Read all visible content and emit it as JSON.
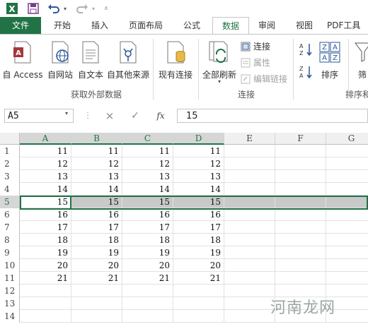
{
  "tabs": [
    "文件",
    "开始",
    "插入",
    "页面布局",
    "公式",
    "数据",
    "审阅",
    "视图",
    "PDF工具"
  ],
  "active_tab": "数据",
  "ribbon": {
    "buttons": [
      "自 Access",
      "自网站",
      "自文本",
      "自其他来源",
      "现有连接",
      "全部刷新",
      "排序",
      "筛"
    ],
    "small_items": [
      "连接",
      "属性",
      "编辑链接"
    ],
    "group_labels": [
      "获取外部数据",
      "连接",
      "排序和"
    ]
  },
  "name_box": "A5",
  "formula_value": "15",
  "formula_buttons": [
    "×",
    "✓",
    "fx"
  ],
  "columns": [
    "A",
    "B",
    "C",
    "D",
    "E",
    "F",
    "G"
  ],
  "rows": [
    {
      "num": "1",
      "cells": [
        "11",
        "11",
        "11",
        "11"
      ]
    },
    {
      "num": "2",
      "cells": [
        "12",
        "12",
        "12",
        "12"
      ]
    },
    {
      "num": "3",
      "cells": [
        "13",
        "13",
        "13",
        "13"
      ]
    },
    {
      "num": "4",
      "cells": [
        "14",
        "14",
        "14",
        "14"
      ]
    },
    {
      "num": "5",
      "cells": [
        "15",
        "15",
        "15",
        "15"
      ]
    },
    {
      "num": "6",
      "cells": [
        "16",
        "16",
        "16",
        "16"
      ]
    },
    {
      "num": "7",
      "cells": [
        "17",
        "17",
        "17",
        "17"
      ]
    },
    {
      "num": "8",
      "cells": [
        "18",
        "18",
        "18",
        "18"
      ]
    },
    {
      "num": "9",
      "cells": [
        "19",
        "19",
        "19",
        "19"
      ]
    },
    {
      "num": "10",
      "cells": [
        "20",
        "20",
        "20",
        "20"
      ]
    },
    {
      "num": "11",
      "cells": [
        "21",
        "21",
        "21",
        "21"
      ]
    },
    {
      "num": "12",
      "cells": [
        "",
        "",
        "",
        ""
      ]
    },
    {
      "num": "13",
      "cells": [
        "",
        "",
        "",
        ""
      ]
    },
    {
      "num": "14",
      "cells": [
        "",
        "",
        "",
        ""
      ]
    }
  ],
  "selected_row": "5",
  "watermark": "河南龙网",
  "colors": {
    "accent": "#217346",
    "highlight": "#c9c9c9"
  }
}
